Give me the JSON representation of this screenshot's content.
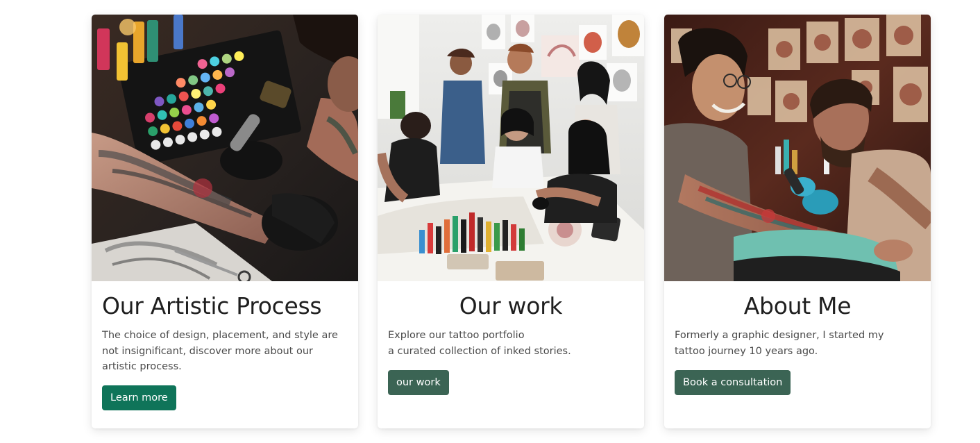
{
  "cards": [
    {
      "title": "Our Artistic Process",
      "text_lines": [
        "The choice of design, placement, and style are",
        "not insignificant, discover more about our",
        "artistic process."
      ],
      "button_label": "Learn more",
      "button_color": "#0f7459"
    },
    {
      "title": "Our work",
      "text_lines": [
        "Explore our tattoo portfolio",
        "a curated collection of inked stories."
      ],
      "button_label": "our work",
      "button_color": "#3b6454"
    },
    {
      "title": "About Me",
      "text_lines": [
        "Formerly a graphic designer, I started my",
        "tattoo journey 10 years ago."
      ],
      "button_label": "Book a consultation",
      "button_color": "#3b6454"
    }
  ]
}
